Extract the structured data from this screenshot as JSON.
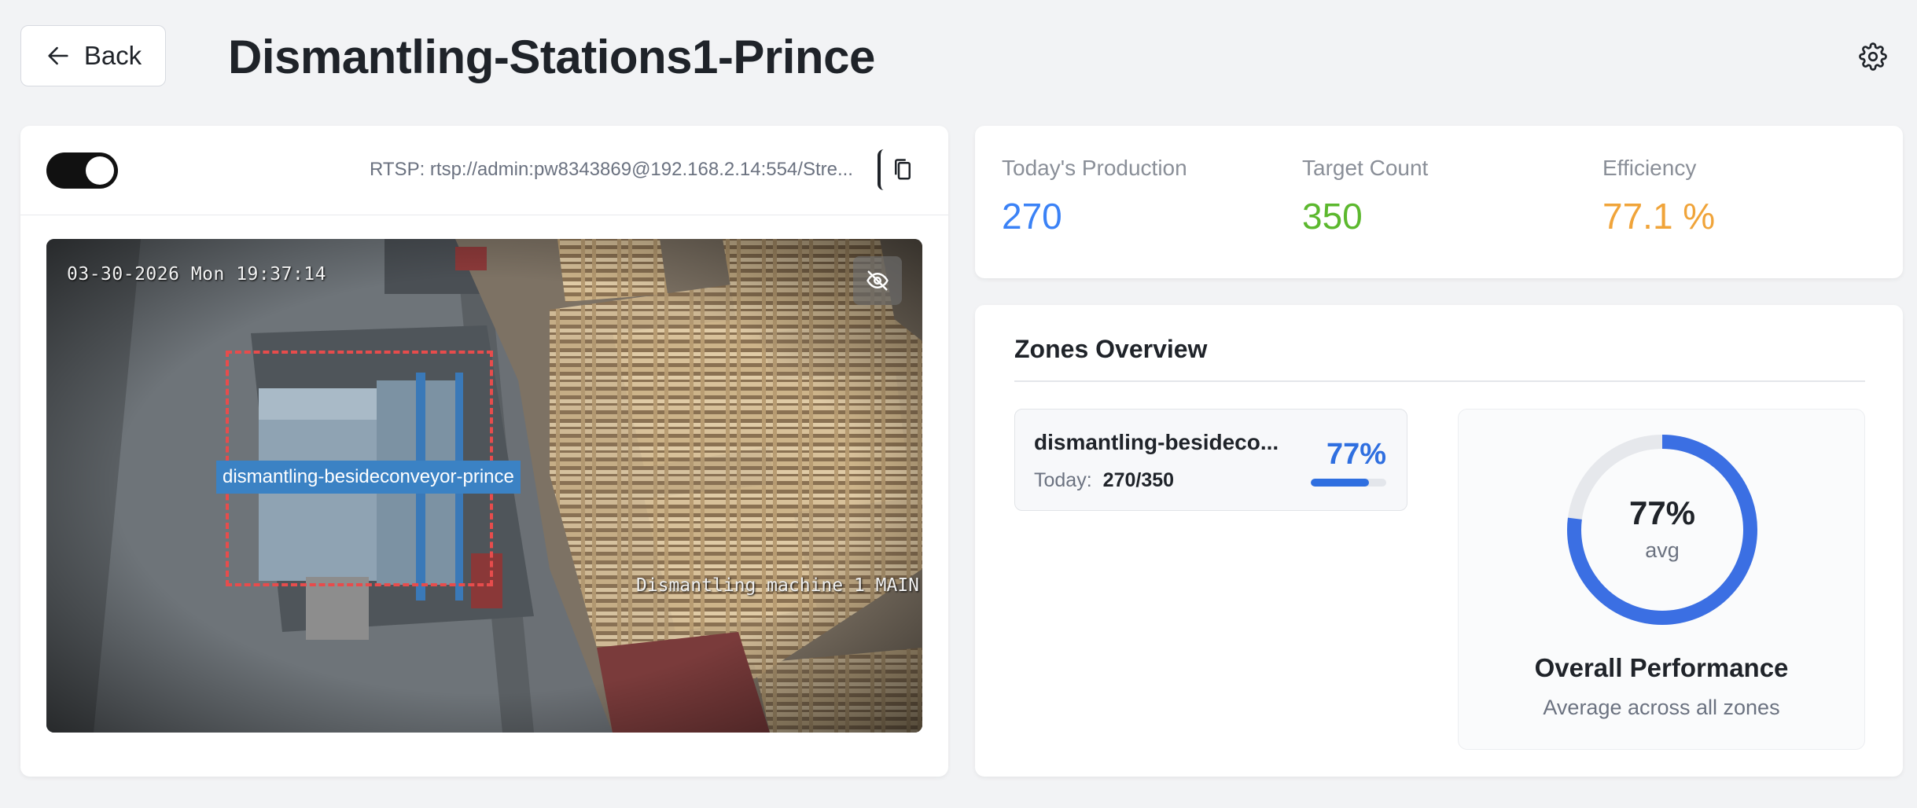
{
  "header": {
    "back_label": "Back",
    "title": "Dismantling-Stations1-Prince",
    "settings_icon": "gear-icon"
  },
  "camera": {
    "toggle_on": true,
    "rtsp_text": "RTSP: rtsp://admin:pw8343869@192.168.2.14:554/Stre...",
    "copy_icon": "copy-icon",
    "timestamp": "03-30-2026 Mon 19:37:14",
    "osd_text": "Dismantling machine 1 MAIN",
    "hide_icon": "eye-off-icon",
    "zone_label": "dismantling-besideconveyor-prince"
  },
  "stats": {
    "production": {
      "label": "Today's Production",
      "value": "270"
    },
    "target": {
      "label": "Target Count",
      "value": "350"
    },
    "efficiency": {
      "label": "Efficiency",
      "value": "77.1 %"
    }
  },
  "zones": {
    "title": "Zones Overview",
    "items": [
      {
        "name": "dismantling-besideco...",
        "today_label": "Today:",
        "today_value": "270/350",
        "percent": "77%",
        "progress": 0.77
      }
    ],
    "overall": {
      "percent": "77%",
      "sub": "avg",
      "title": "Overall Performance",
      "subtitle": "Average across all zones",
      "progress": 0.77
    }
  },
  "colors": {
    "production": "#3b82f6",
    "target": "#5cb82e",
    "efficiency": "#f0a43a",
    "zone_accent": "#2f6fe0",
    "zone_box": "#e74c4c",
    "zone_label_bg": "#3b82c4"
  }
}
